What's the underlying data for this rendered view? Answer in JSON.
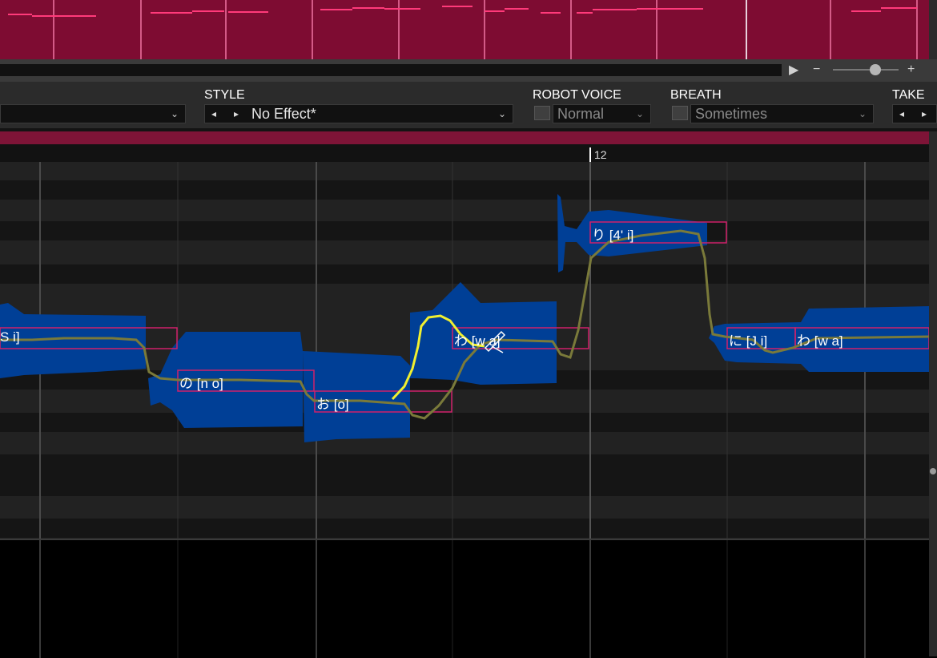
{
  "transport": {
    "play_icon": "▶",
    "zoom_out": "−",
    "zoom_in": "+"
  },
  "parameters": {
    "style": {
      "label": "STYLE",
      "value": "No Effect*",
      "prev": "◂",
      "next": "▸"
    },
    "robot_voice": {
      "label": "ROBOT VOICE",
      "value": "Normal"
    },
    "breath": {
      "label": "BREATH",
      "value": "Sometimes"
    },
    "take": {
      "label": "TAKE",
      "prev": "◂",
      "next": "▸"
    }
  },
  "ruler": {
    "measure": "12"
  },
  "notes": [
    {
      "label": "S i]"
    },
    {
      "label": "の [n o]"
    },
    {
      "label": "お [o]"
    },
    {
      "label": "わ [w a]"
    },
    {
      "label": "り [4' i]"
    },
    {
      "label": "に [J i]"
    },
    {
      "label": "わ [w a]"
    }
  ],
  "colors": {
    "overview_bg": "#7e0c32",
    "waveform": "#003f96",
    "note_border": "#d0206a",
    "pitch_curve": "#7a7a3a",
    "pitch_edit": "#f0f030"
  }
}
